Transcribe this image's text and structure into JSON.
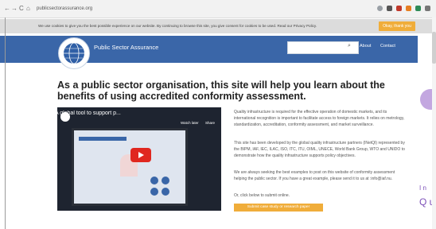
{
  "browser": {
    "back": "←",
    "forward": "→",
    "reload": "C",
    "home": "⌂",
    "url": "publicsectorassurance.org"
  },
  "cookie_banner": {
    "text": "We use cookies to give you the best possible experience on our website. By continuing to browse this site, you give consent for cookies to be used. Read our Privacy Policy.",
    "accept_label": "Okay, thank you"
  },
  "header": {
    "brand": "Public Sector Assurance",
    "search_placeholder": "",
    "nav": [
      "About",
      "Contact"
    ]
  },
  "main": {
    "heading": "As a public sector organisation, this site will help you learn about the benefits of using accredited conformity assessment.",
    "video": {
      "title": "Accreditation: A global tool to support p...",
      "watch_later": "Watch later",
      "share": "Share"
    },
    "paragraphs": [
      "Quality infrastructure is required for the effective operation of domestic markets, and its international recognition is important to facilitate access to foreign markets. It relies on metrology, standardization, accreditation, conformity assessment, and market surveillance.",
      "This site has been developed by the global quality infrastructure partners (INetQI) represented by the BIPM, IAF, IEC, ILAC, ISO, ITC, ITU, OIML, UNECE, World Bank Group, WTO and UNIDO to demonstrate how the quality infrastructure supports policy objectives.",
      "We are always seeking the best examples to post on this website of conformity assessment helping the public sector. If you have a great example, please send it to us at :info@iaf.nu.",
      "Or, click below to submit online."
    ],
    "cta_label": "Submit case study or research paper"
  },
  "side_overlay": {
    "line1": "I n",
    "line2": "Q u"
  },
  "colors": {
    "header": "#3a66a8",
    "accent": "#f0ad3a",
    "purple": "#7c4fb8"
  }
}
